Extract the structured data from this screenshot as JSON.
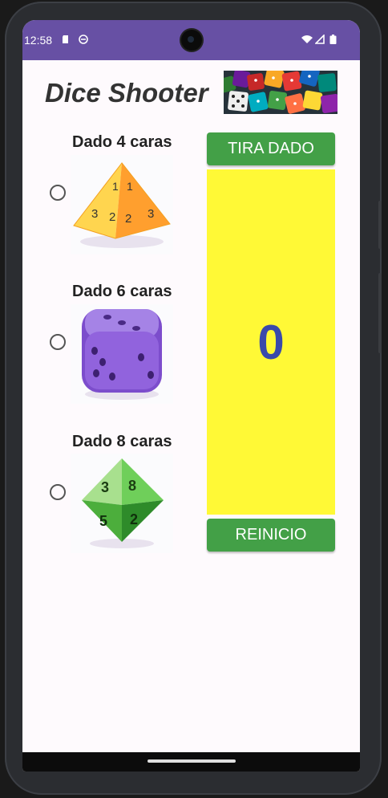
{
  "status_bar": {
    "time": "12:58",
    "icons": [
      "sd-card-icon",
      "app-notification-icon",
      "wifi-icon",
      "signal-icon",
      "battery-icon"
    ]
  },
  "app": {
    "title": "Dice Shooter",
    "banner_image": "colorful-dice-pile"
  },
  "dice_options": [
    {
      "label": "Dado 4 caras",
      "selected": false,
      "image": "d4-yellow-tetrahedron",
      "color": "#ffc94a"
    },
    {
      "label": "Dado 6 caras",
      "selected": false,
      "image": "d6-purple-cube",
      "color": "#9b6fe0"
    },
    {
      "label": "Dado 8 caras",
      "selected": false,
      "image": "d8-green-octahedron",
      "color": "#66c655"
    }
  ],
  "buttons": {
    "roll_label": "TIRA DADO",
    "reset_label": "REINICIO"
  },
  "result": {
    "value": "0"
  },
  "colors": {
    "status_bar": "#6750a4",
    "button": "#43a047",
    "result_bg": "#fff936",
    "result_text": "#3949ab"
  }
}
